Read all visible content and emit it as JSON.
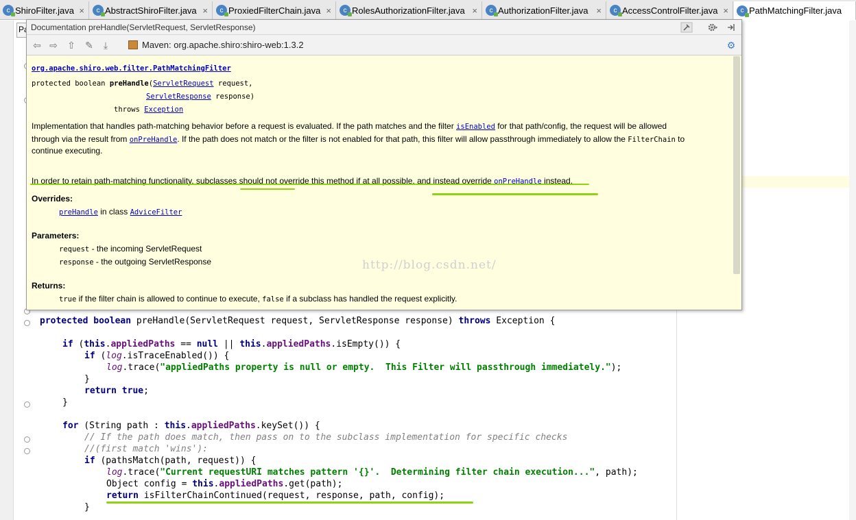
{
  "tabs": [
    {
      "label": "ShiroFilter.java",
      "active": false
    },
    {
      "label": "AbstractShiroFilter.java",
      "active": false
    },
    {
      "label": "ProxiedFilterChain.java",
      "active": false
    },
    {
      "label": "RolesAuthorizationFilter.java",
      "active": false
    },
    {
      "label": "AuthorizationFilter.java",
      "active": false
    },
    {
      "label": "AccessControlFilter.java",
      "active": false
    },
    {
      "label": "PathMatchingFilter.java",
      "active": true
    }
  ],
  "tab_close": "×",
  "tab_icon_letter": "c",
  "breadcrumb": "Pa",
  "popup": {
    "title": "Documentation preHandle(ServletRequest, ServletResponse)",
    "maven": "Maven: org.apache.shiro:shiro-web:1.3.2",
    "class_link": "org.apache.shiro.web.filter.PathMatchingFilter",
    "sig_protected": "protected",
    "sig_boolean": "boolean",
    "sig_name": "preHandle",
    "sig_paren_open": "(",
    "sig_type1": "ServletRequest",
    "sig_param1": "request,",
    "sig_type2": "ServletResponse",
    "sig_param2": "response)",
    "sig_throws": "throws",
    "sig_exception": "Exception",
    "desc1_a": "Implementation that handles path-matching behavior before a request is evaluated. If the path matches and the filter ",
    "desc1_link": "isEnabled",
    "desc1_b": " for that path/config, the request will be allowed",
    "desc2_a": "through via the result from ",
    "desc2_link": "onPreHandle",
    "desc2_b": ". If the path does not match or the filter is not enabled for that path, this filter will allow passthrough immediately to allow the ",
    "desc2_code": "FilterChain",
    "desc2_c": " to",
    "desc3": "continue executing.",
    "desc4_a": "In order to retain path-matching functionality, subclasses should not override this method if at all possible, and instead override ",
    "desc4_link": "onPreHandle",
    "desc4_b": " instead.",
    "overrides_h": "Overrides:",
    "overrides_link1": "preHandle",
    "overrides_mid": " in class ",
    "overrides_link2": "AdviceFilter",
    "params_h": "Parameters:",
    "param1_name": "request",
    "param1_desc": " - the incoming ServletRequest",
    "param2_name": "response",
    "param2_desc": " - the outgoing ServletResponse",
    "returns_h": "Returns:",
    "ret_true": "true",
    "ret_mid": " if the filter chain is allowed to continue to execute, ",
    "ret_false": "false",
    "ret_end": " if a subclass has handled the request explicitly."
  },
  "watermark": "http://blog.csdn.net/",
  "code": {
    "l1_kw1": "protected",
    "l1_kw2": "boolean",
    "l1_a": " preHandle(ServletRequest request, ServletResponse response) ",
    "l1_kw3": "throws",
    "l1_b": " Exception {",
    "l2_if": "if",
    "l2_a": " (",
    "l2_this": "this",
    "l2_dot": ".",
    "l2_fld": "appliedPaths",
    "l2_b": " == ",
    "l2_null": "null",
    "l2_c": " || ",
    "l2_this2": "this",
    "l2_dot2": ".",
    "l2_fld2": "appliedPaths",
    "l2_d": ".isEmpty()) {",
    "l3_if": "if",
    "l3_a": " (",
    "l3_log": "log",
    "l3_b": ".isTraceEnabled()) {",
    "l4_log": "log",
    "l4_a": ".trace(",
    "l4_str": "\"appliedPaths property is null or empty.  This Filter will passthrough immediately.\"",
    "l4_b": ");",
    "l5": "}",
    "l6_ret": "return",
    "l6_true": "true",
    "l6_semi": ";",
    "l7": "}",
    "l8_for": "for",
    "l8_a": " (String path : ",
    "l8_this": "this",
    "l8_dot": ".",
    "l8_fld": "appliedPaths",
    "l8_b": ".keySet()) {",
    "l9": "// If the path does match, then pass on to the subclass implementation for specific checks",
    "l10": "//(first match 'wins'):",
    "l11_if": "if",
    "l11_a": " (pathsMatch(path, request)) {",
    "l12_log": "log",
    "l12_a": ".trace(",
    "l12_str": "\"Current requestURI matches pattern '{}'.  Determining filter chain execution...\"",
    "l12_b": ", path);",
    "l13_a": "Object config = ",
    "l13_this": "this",
    "l13_dot": ".",
    "l13_fld": "appliedPaths",
    "l13_b": ".get(path);",
    "l14_ret": "return",
    "l14_a": " isFilterChainContinued(request, response, path, config);",
    "l15": "}"
  }
}
